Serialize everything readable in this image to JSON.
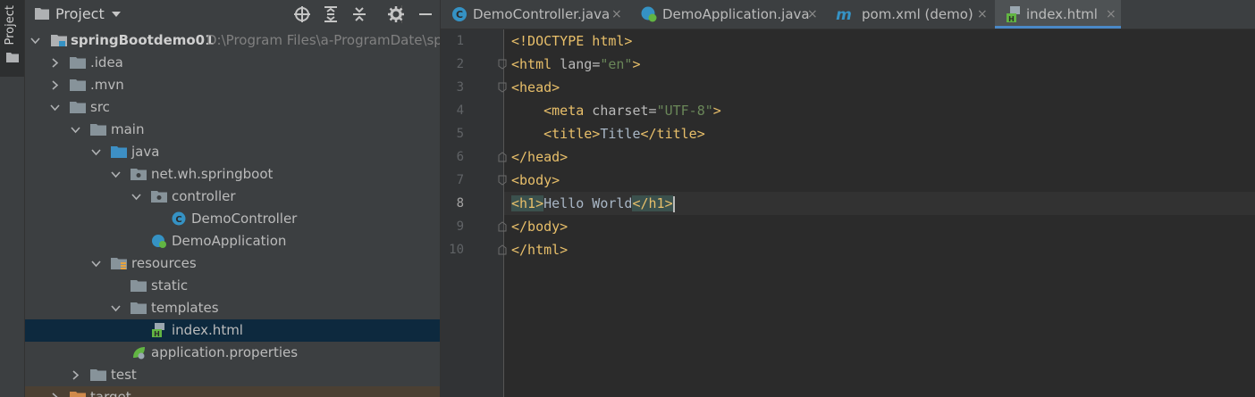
{
  "tool_window": {
    "stripe_label": "Project",
    "title": "Project"
  },
  "tree": [
    {
      "label": "springBootdemo01",
      "path": "D:\\Program Files\\a-ProgramDate\\sp",
      "icon": "module-folder-icon",
      "expanded": true
    },
    {
      "label": ".idea",
      "icon": "folder-icon",
      "expanded": false
    },
    {
      "label": ".mvn",
      "icon": "folder-icon",
      "expanded": false
    },
    {
      "label": "src",
      "icon": "folder-icon",
      "expanded": true
    },
    {
      "label": "main",
      "icon": "folder-icon",
      "expanded": true
    },
    {
      "label": "java",
      "icon": "source-folder-icon",
      "expanded": true
    },
    {
      "label": "net.wh.springboot",
      "icon": "package-icon",
      "expanded": true
    },
    {
      "label": "controller",
      "icon": "package-icon",
      "expanded": true
    },
    {
      "label": "DemoController",
      "icon": "java-class-icon"
    },
    {
      "label": "DemoApplication",
      "icon": "spring-boot-app-icon"
    },
    {
      "label": "resources",
      "icon": "resources-folder-icon",
      "expanded": true
    },
    {
      "label": "static",
      "icon": "folder-icon"
    },
    {
      "label": "templates",
      "icon": "folder-icon",
      "expanded": true
    },
    {
      "label": "index.html",
      "icon": "html-file-icon",
      "selected": true
    },
    {
      "label": "application.properties",
      "icon": "spring-properties-icon"
    },
    {
      "label": "test",
      "icon": "folder-icon",
      "expanded": false
    },
    {
      "label": "target",
      "icon": "excluded-folder-icon",
      "expanded": false
    }
  ],
  "tabs": [
    {
      "label": "DemoController.java",
      "icon": "java-class-icon",
      "active": false
    },
    {
      "label": "DemoApplication.java",
      "icon": "spring-boot-app-icon",
      "active": false
    },
    {
      "label": "pom.xml (demo)",
      "icon": "maven-icon",
      "active": false
    },
    {
      "label": "index.html",
      "icon": "html-file-icon",
      "active": true
    }
  ],
  "tab_close_glyph": "×",
  "editor": {
    "current_line": 8,
    "lines": [
      {
        "n": "1",
        "text": "<!DOCTYPE html>"
      },
      {
        "n": "2",
        "text": "<html lang=\"en\">"
      },
      {
        "n": "3",
        "text": "<head>"
      },
      {
        "n": "4",
        "text": "    <meta charset=\"UTF-8\">"
      },
      {
        "n": "5",
        "text": "    <title>Title</title>"
      },
      {
        "n": "6",
        "text": "</head>"
      },
      {
        "n": "7",
        "text": "<body>"
      },
      {
        "n": "8",
        "text": "<h1>Hello World</h1>"
      },
      {
        "n": "9",
        "text": "</body>"
      },
      {
        "n": "10",
        "text": "</html>"
      }
    ]
  },
  "colors": {
    "tag": "#e8bf6a",
    "attr_value": "#6a8759",
    "text": "#a9b7c6",
    "selection": "#0d293e",
    "tab_underline": "#4a88c7"
  }
}
